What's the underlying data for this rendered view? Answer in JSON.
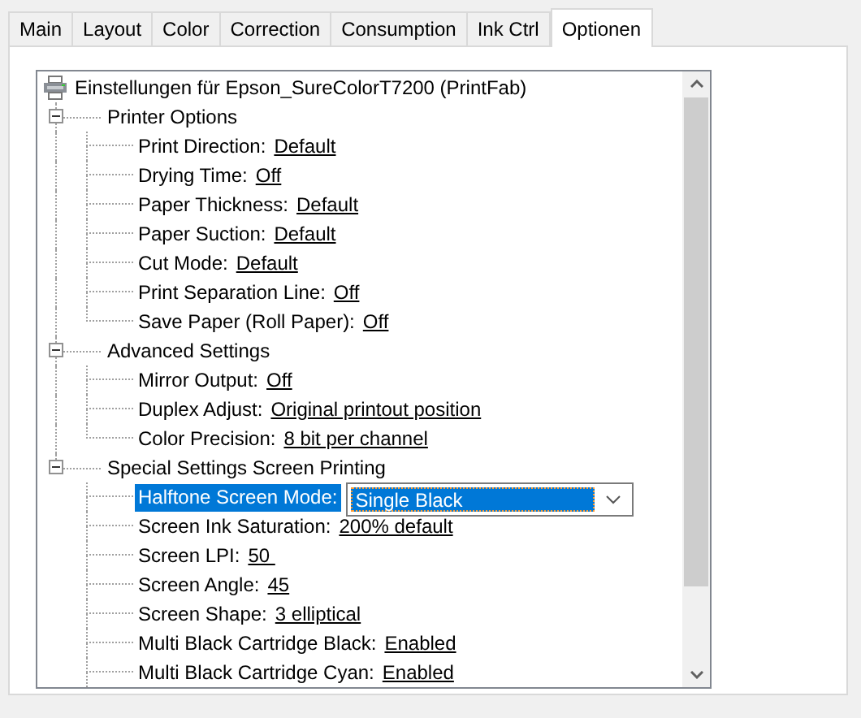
{
  "tabs": [
    {
      "label": "Main",
      "selected": false
    },
    {
      "label": "Layout",
      "selected": false
    },
    {
      "label": "Color",
      "selected": false
    },
    {
      "label": "Correction",
      "selected": false
    },
    {
      "label": "Consumption",
      "selected": false
    },
    {
      "label": "Ink Ctrl",
      "selected": false
    },
    {
      "label": "Optionen",
      "selected": true
    }
  ],
  "tree": {
    "label": "Einstellungen für Epson_SureColorT7200 (PrintFab)",
    "groups": [
      {
        "label": "Printer Options",
        "expanded": true,
        "children": [
          {
            "kind": "link",
            "label": "Print Direction:",
            "value": "Default",
            "selected": false
          },
          {
            "kind": "link",
            "label": "Drying Time:",
            "value": "Off",
            "selected": false
          },
          {
            "kind": "link",
            "label": "Paper Thickness:",
            "value": "Default",
            "selected": false
          },
          {
            "kind": "link",
            "label": "Paper Suction:",
            "value": "Default",
            "selected": false
          },
          {
            "kind": "link",
            "label": "Cut Mode:",
            "value": "Default",
            "selected": false
          },
          {
            "kind": "link",
            "label": "Print Separation Line:",
            "value": "Off",
            "selected": false
          },
          {
            "kind": "link",
            "label": "Save Paper (Roll Paper):",
            "value": "Off",
            "selected": false
          }
        ]
      },
      {
        "label": "Advanced Settings",
        "expanded": true,
        "children": [
          {
            "kind": "link",
            "label": "Mirror Output:",
            "value": "Off",
            "selected": false
          },
          {
            "kind": "link",
            "label": "Duplex Adjust:",
            "value": "Original printout position",
            "selected": false
          },
          {
            "kind": "link",
            "label": "Color Precision:",
            "value": "8 bit per channel",
            "selected": false
          }
        ]
      },
      {
        "label": "Special Settings Screen Printing",
        "expanded": true,
        "children": [
          {
            "kind": "dropdown",
            "label": "Halftone Screen Mode:",
            "value": "Single Black",
            "selected": true
          },
          {
            "kind": "link",
            "label": "Screen Ink Saturation:",
            "value": "200% default",
            "selected": false
          },
          {
            "kind": "link",
            "label": "Screen LPI:",
            "value": "50 ",
            "selected": false
          },
          {
            "kind": "link",
            "label": "Screen Angle:",
            "value": "45",
            "selected": false
          },
          {
            "kind": "link",
            "label": "Screen Shape:",
            "value": "3 elliptical",
            "selected": false
          },
          {
            "kind": "link",
            "label": "Multi Black Cartridge Black:",
            "value": "Enabled",
            "selected": false
          },
          {
            "kind": "link",
            "label": "Multi Black Cartridge Cyan:",
            "value": "Enabled",
            "selected": false
          }
        ]
      }
    ]
  }
}
